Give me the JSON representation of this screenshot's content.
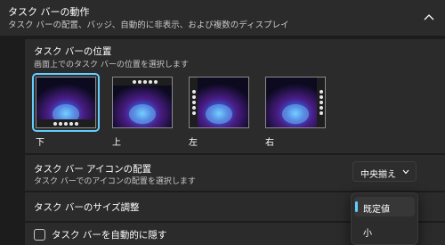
{
  "section": {
    "title": "タスク バーの動作",
    "subtitle": "タスク バーの配置、バッジ、自動的に非表示、および複数のディスプレイ",
    "chevron_icon": "chevron-up-icon"
  },
  "position": {
    "title": "タスク バーの位置",
    "subtitle": "画面上でのタスク バーの位置を選択します",
    "options": [
      {
        "label": "下",
        "selected": true
      },
      {
        "label": "上",
        "selected": false
      },
      {
        "label": "左",
        "selected": false
      },
      {
        "label": "右",
        "selected": false
      }
    ]
  },
  "alignment": {
    "title": "タスク バー アイコンの配置",
    "subtitle": "タスク バーでのアイコンの配置を選択します",
    "value": "中央揃え"
  },
  "size": {
    "title": "タスク バーのサイズ調整"
  },
  "auto_hide": {
    "label": "タスク バーを自動的に隠す",
    "checked": false
  },
  "size_menu": {
    "items": [
      {
        "label": "既定値",
        "selected": true
      },
      {
        "label": "小",
        "selected": false
      }
    ]
  },
  "colors": {
    "accent": "#62cdfe",
    "background": "#1c1c1c",
    "card": "#2b2b2b"
  }
}
